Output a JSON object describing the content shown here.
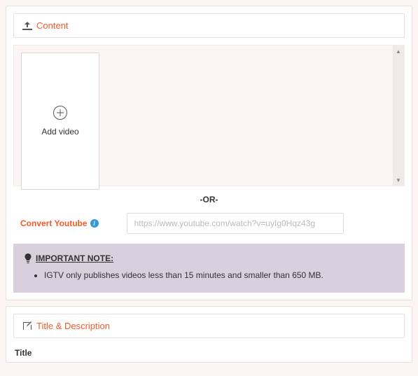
{
  "content_panel": {
    "header_label": "Content",
    "add_video_label": "Add video",
    "or_separator": "-OR-",
    "convert_label": "Convert Youtube",
    "convert_placeholder": "https://www.youtube.com/watch?v=uyIg0Hqz43g",
    "note_header": "IMPORTANT NOTE:",
    "note_items": [
      "IGTV only publishes videos less than 15 minutes and smaller than 650 MB."
    ]
  },
  "title_panel": {
    "header_label": "Title & Description",
    "title_field_label": "Title"
  }
}
